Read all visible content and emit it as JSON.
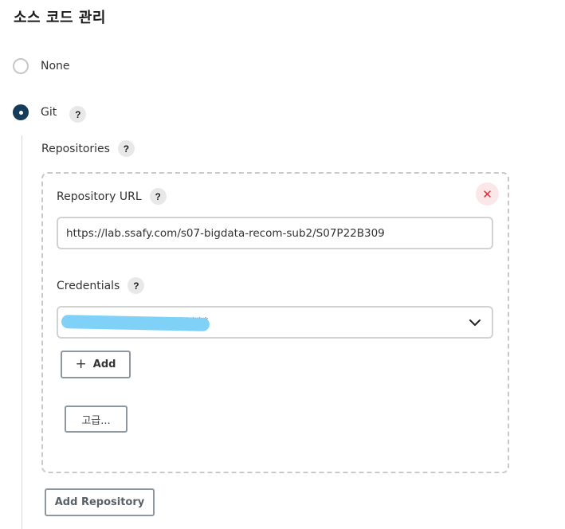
{
  "section": {
    "title": "소스 코드 관리"
  },
  "scm_options": {
    "none_label": "None",
    "git_label": "Git",
    "selected": "Git"
  },
  "help_icon_text": "?",
  "repositories": {
    "label": "Repositories",
    "items": [
      {
        "url_label": "Repository URL",
        "url_value": "https://lab.ssafy.com/s07-bigdata-recom-sub2/S07P22B309",
        "credentials_label": "Credentials",
        "credentials_value": "*****",
        "delete_symbol": "✕",
        "add_label": "Add",
        "add_symbol": "+",
        "advanced_label": "고급..."
      }
    ],
    "add_repository_label": "Add Repository"
  },
  "icons": {
    "delete": "close-icon",
    "help": "question-icon",
    "dropdown": "chevron-down-icon",
    "add": "plus-icon"
  },
  "colors": {
    "radio_checked": "#163c5c",
    "delete_fg": "#d6323e",
    "delete_bg": "#fbe6e8",
    "redaction": "#7fd1f8"
  }
}
